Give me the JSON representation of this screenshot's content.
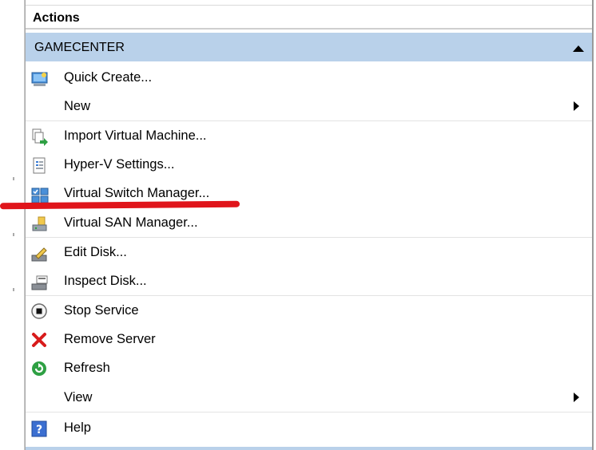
{
  "pane": {
    "title": "Actions",
    "section": "GAMECENTER"
  },
  "items": [
    {
      "label": "Quick Create...",
      "icon": "quick-create-icon"
    },
    {
      "label": "New",
      "icon": null,
      "submenu": true
    },
    {
      "label": "Import Virtual Machine...",
      "icon": "import-vm-icon"
    },
    {
      "label": "Hyper-V Settings...",
      "icon": "settings-document-icon"
    },
    {
      "label": "Virtual Switch Manager...",
      "icon": "switch-grid-icon"
    },
    {
      "label": "Virtual SAN Manager...",
      "icon": "san-manager-icon"
    },
    {
      "label": "Edit Disk...",
      "icon": "edit-disk-icon"
    },
    {
      "label": "Inspect Disk...",
      "icon": "inspect-disk-icon"
    },
    {
      "label": "Stop Service",
      "icon": "stop-icon"
    },
    {
      "label": "Remove Server",
      "icon": "red-x-icon"
    },
    {
      "label": "Refresh",
      "icon": "refresh-icon"
    },
    {
      "label": "View",
      "icon": null,
      "submenu": true
    },
    {
      "label": "Help",
      "icon": "help-icon"
    }
  ],
  "colors": {
    "section_bg": "#b9d1ea",
    "annotation_red": "#e0151b"
  }
}
